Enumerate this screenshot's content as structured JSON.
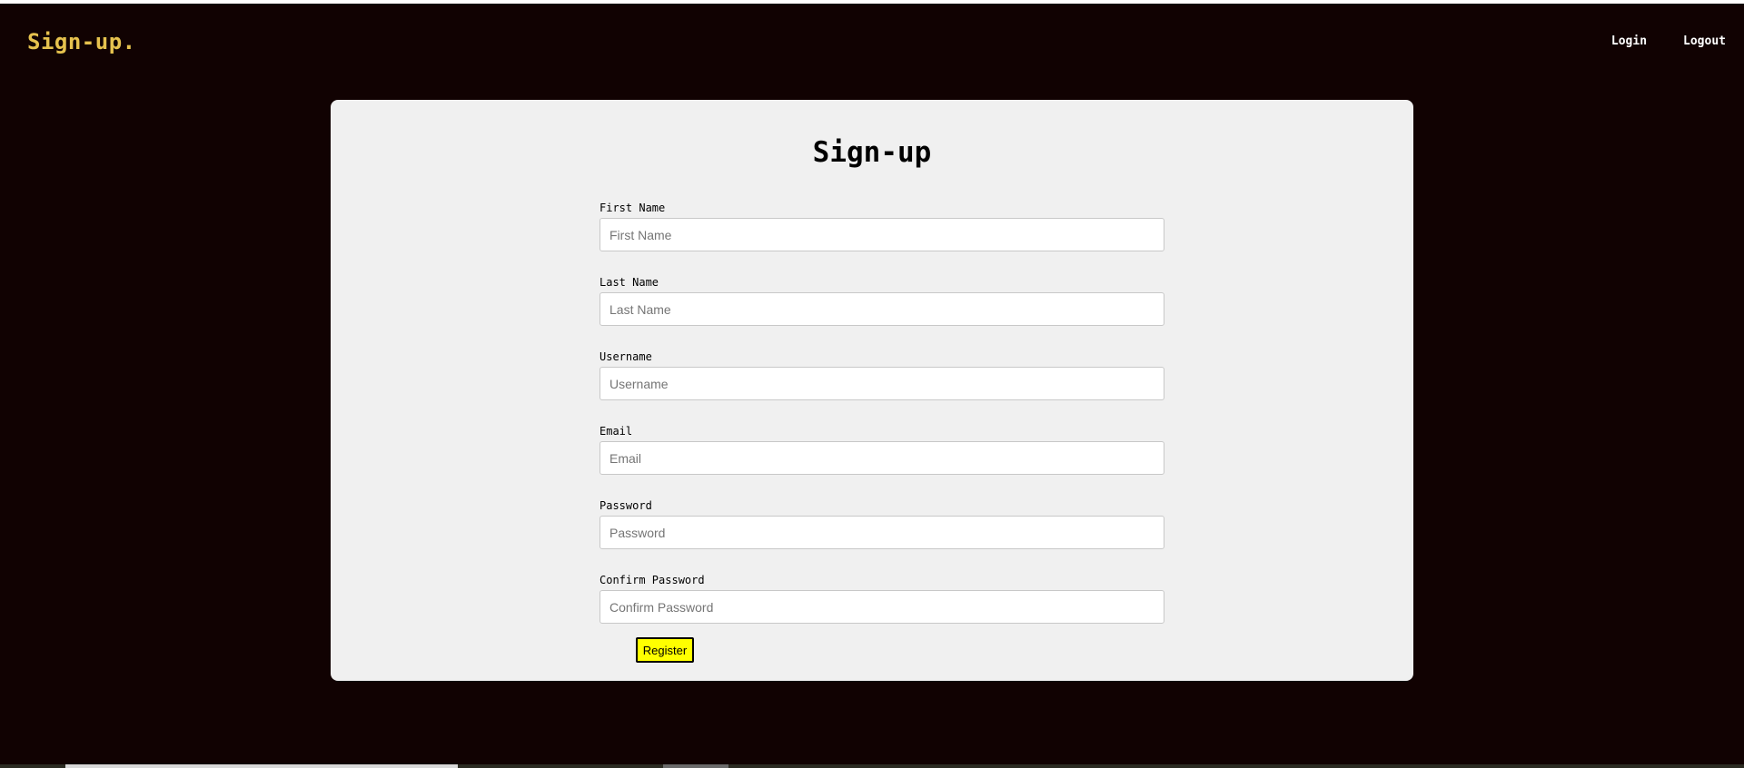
{
  "navbar": {
    "brand": "Sign-up.",
    "links": [
      {
        "label": "Login"
      },
      {
        "label": "Logout"
      }
    ]
  },
  "form": {
    "title": "Sign-up",
    "fields": [
      {
        "label": "First Name",
        "placeholder": "First Name",
        "value": ""
      },
      {
        "label": "Last Name",
        "placeholder": "Last Name",
        "value": ""
      },
      {
        "label": "Username",
        "placeholder": "Username",
        "value": ""
      },
      {
        "label": "Email",
        "placeholder": "Email",
        "value": ""
      },
      {
        "label": "Password",
        "placeholder": "Password",
        "value": ""
      },
      {
        "label": "Confirm Password",
        "placeholder": "Confirm Password",
        "value": ""
      }
    ],
    "submit_label": "Register"
  },
  "colors": {
    "background": "#110202",
    "brand": "#e6c24e",
    "card": "#f0f0f0",
    "button": "#ffff00"
  }
}
